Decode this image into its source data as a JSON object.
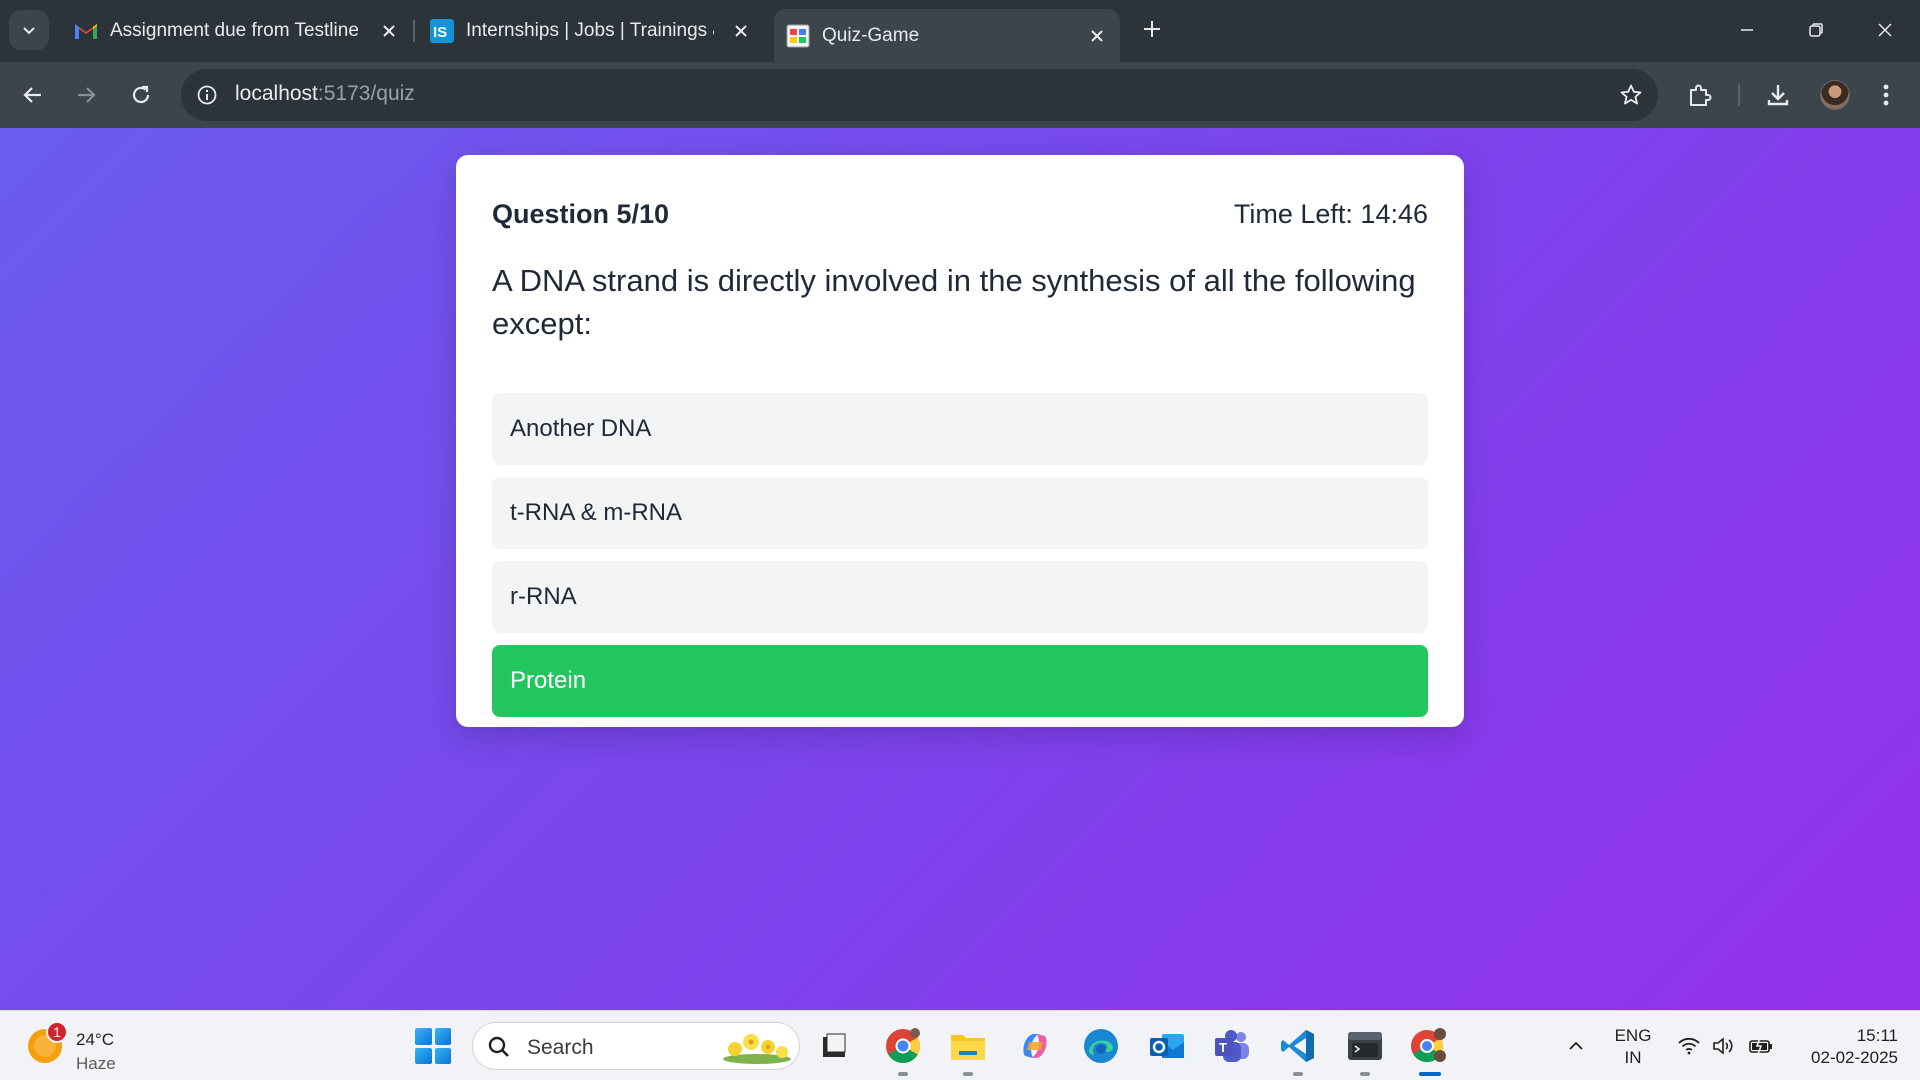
{
  "browser": {
    "tabs": [
      {
        "title": "Assignment due from Testline -",
        "favicon": "gmail-icon",
        "active": false
      },
      {
        "title": "Internships | Jobs | Trainings & I",
        "favicon": "internshala-icon",
        "active": false
      },
      {
        "title": "Quiz-Game",
        "favicon": "quiz-game-icon",
        "active": true
      }
    ],
    "url_host": "localhost",
    "url_path": ":5173/quiz"
  },
  "quiz": {
    "counter": "Question 5/10",
    "timer": "Time Left: 14:46",
    "question": "A DNA strand is directly involved in the synthesis of all the following except:",
    "options": [
      {
        "label": "Another DNA",
        "selected": false
      },
      {
        "label": "t-RNA & m-RNA",
        "selected": false
      },
      {
        "label": "r-RNA",
        "selected": false
      },
      {
        "label": "Protein",
        "selected": true
      }
    ],
    "colors": {
      "selected": "#22c55e",
      "option_bg": "#f3f4f6",
      "card": "#ffffff"
    }
  },
  "taskbar": {
    "weather_temp": "24°C",
    "weather_condition": "Haze",
    "weather_badge": "1",
    "search_placeholder": "Search",
    "apps": [
      "file-icon",
      "chrome-icon",
      "file-explorer-icon",
      "copilot-icon",
      "edge-icon",
      "outlook-icon",
      "teams-icon",
      "vscode-icon",
      "terminal-icon",
      "chrome-profile-icon"
    ],
    "lang_line1": "ENG",
    "lang_line2": "IN",
    "time": "15:11",
    "date": "02-02-2025"
  }
}
